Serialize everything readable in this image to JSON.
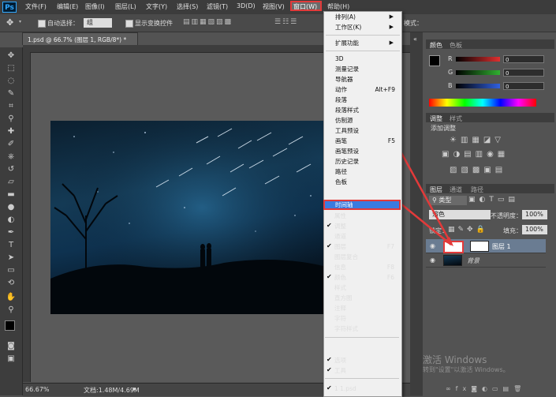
{
  "app": {
    "logo": "Ps"
  },
  "menubar": {
    "items": [
      "文件(F)",
      "编辑(E)",
      "图像(I)",
      "图层(L)",
      "文字(Y)",
      "选择(S)",
      "滤镜(T)",
      "3D(D)",
      "视图(V)",
      "窗口(W)",
      "帮助(H)"
    ]
  },
  "optionsbar": {
    "auto_select_label": "自动选择：",
    "auto_select_value": "组",
    "show_transform_label": "显示变换控件",
    "mode_label": "模式："
  },
  "document": {
    "tab_title": "1.psd @ 66.7% (图层 1, RGB/8*) *",
    "zoom": "66.67%",
    "doc_info": "文档:1.48M/4.69M"
  },
  "window_menu": {
    "items": [
      {
        "label": "排列(A)",
        "submenu": true
      },
      {
        "label": "工作区(K)",
        "submenu": true
      },
      {
        "label": "扩展功能",
        "submenu": true
      },
      {
        "label": "3D"
      },
      {
        "label": "测量记录"
      },
      {
        "label": "导航器"
      },
      {
        "label": "动作",
        "shortcut": "Alt+F9"
      },
      {
        "label": "段落"
      },
      {
        "label": "段落样式"
      },
      {
        "label": "仿制源"
      },
      {
        "label": "工具预设"
      },
      {
        "label": "画笔",
        "shortcut": "F5"
      },
      {
        "label": "画笔预设"
      },
      {
        "label": "历史记录"
      },
      {
        "label": "路径"
      },
      {
        "label": "色板"
      },
      {
        "label": "时间轴",
        "highlighted": true
      },
      {
        "label": "属性"
      },
      {
        "label": "调整",
        "checked": true
      },
      {
        "label": "通道"
      },
      {
        "label": "图层",
        "shortcut": "F7",
        "checked": true
      },
      {
        "label": "图层复合"
      },
      {
        "label": "信息",
        "shortcut": "F8"
      },
      {
        "label": "颜色",
        "shortcut": "F6",
        "checked": true
      },
      {
        "label": "样式"
      },
      {
        "label": "直方图"
      },
      {
        "label": "注释"
      },
      {
        "label": "字符"
      },
      {
        "label": "字符样式"
      },
      {
        "label": "选项",
        "checked": true
      },
      {
        "label": "工具",
        "checked": true
      },
      {
        "label": "1 1.psd",
        "checked": true
      }
    ]
  },
  "color_panel": {
    "tabs": [
      "颜色",
      "色板"
    ],
    "channels": [
      {
        "label": "R",
        "value": "0",
        "color": "#e03030"
      },
      {
        "label": "G",
        "value": "0",
        "color": "#30b030"
      },
      {
        "label": "B",
        "value": "0",
        "color": "#3060e0"
      }
    ]
  },
  "adjust_panel": {
    "tabs": [
      "调整",
      "样式"
    ],
    "title": "添加调整"
  },
  "layers_panel": {
    "tabs": [
      "图层",
      "通道",
      "路径"
    ],
    "filter_label": "类型",
    "blend_mode": "溶色",
    "opacity_label": "不透明度：",
    "opacity_value": "100%",
    "lock_label": "锁定：",
    "fill_label": "填充：",
    "fill_value": "100%",
    "layers": [
      {
        "name": "图层 1",
        "selected": true
      },
      {
        "name": "背景",
        "selected": false
      }
    ]
  },
  "watermark": {
    "line1": "激活 Windows",
    "line2": "转到\"设置\"以激活 Windows。"
  },
  "accent": {
    "highlight": "#3a7be0",
    "annotation": "#e23a3a"
  }
}
